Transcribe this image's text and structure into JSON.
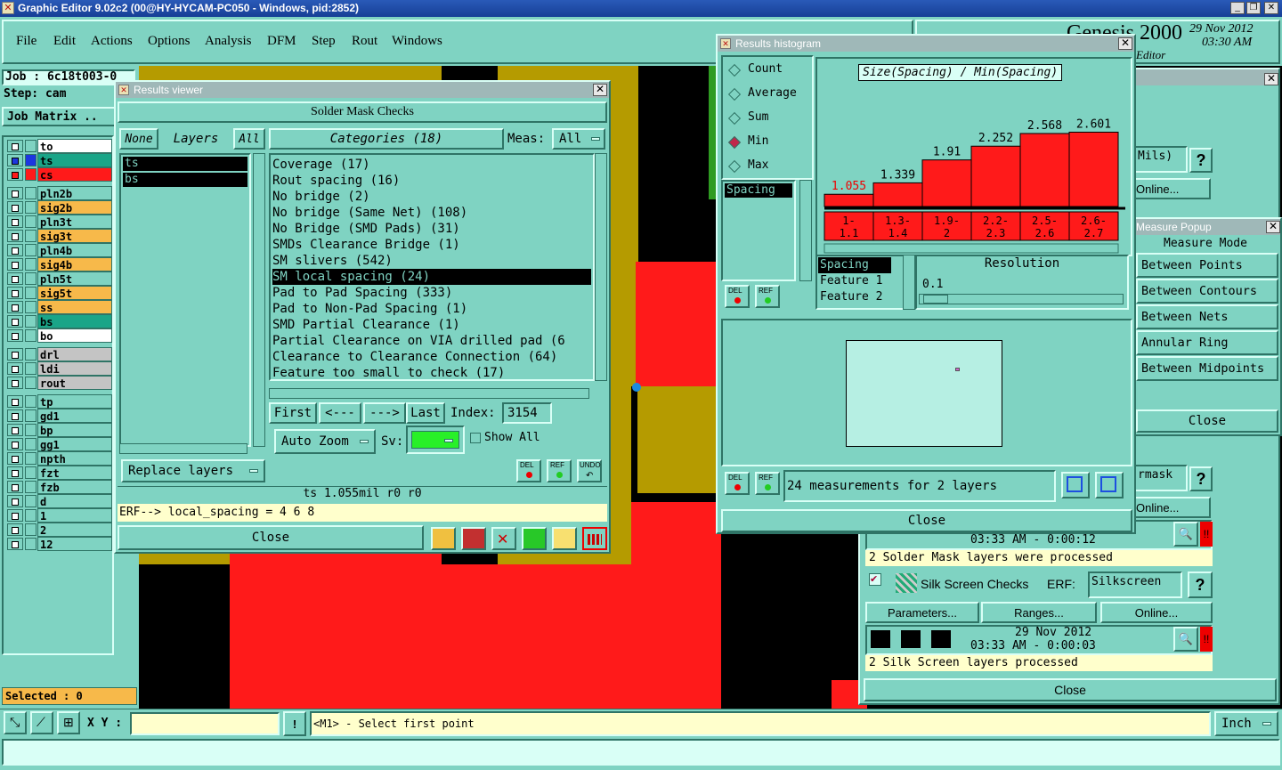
{
  "app": {
    "title": "Graphic Editor 9.02c2 (00@HY-HYCAM-PC050 - Windows, pid:2852)",
    "brand": "Genesis 2000",
    "date": "29 Nov 2012",
    "time": "03:30 AM",
    "sub": "Editor"
  },
  "menu": [
    "File",
    "Edit",
    "Actions",
    "Options",
    "Analysis",
    "DFM",
    "Step",
    "Rout",
    "Windows"
  ],
  "job": {
    "job": "Job : 6c18t003-0",
    "step": "Step: cam",
    "matrix": "Job Matrix .."
  },
  "layers": [
    {
      "name": "to",
      "color": "#ffffff",
      "mark": "none"
    },
    {
      "name": "ts",
      "color": "#1aa588",
      "mark": "blue"
    },
    {
      "name": "cs",
      "color": "#ff1a1a",
      "mark": "red"
    },
    {
      "name": "pln2b",
      "color": "#7fd3c2"
    },
    {
      "name": "sig2b",
      "color": "#f7b94a"
    },
    {
      "name": "pln3t",
      "color": "#7fd3c2"
    },
    {
      "name": "sig3t",
      "color": "#f7b94a"
    },
    {
      "name": "pln4b",
      "color": "#7fd3c2"
    },
    {
      "name": "sig4b",
      "color": "#f7b94a"
    },
    {
      "name": "pln5t",
      "color": "#7fd3c2"
    },
    {
      "name": "sig5t",
      "color": "#f7b94a"
    },
    {
      "name": "ss",
      "color": "#f7b94a"
    },
    {
      "name": "bs",
      "color": "#1aa588"
    },
    {
      "name": "bo",
      "color": "#ffffff"
    },
    {
      "name": "drl",
      "color": "#c4c4c4"
    },
    {
      "name": "ldi",
      "color": "#c4c4c4"
    },
    {
      "name": "rout",
      "color": "#c4c4c4"
    },
    {
      "name": "tp",
      "color": "#7fd3c2"
    },
    {
      "name": "gd1",
      "color": "#7fd3c2"
    },
    {
      "name": "bp",
      "color": "#7fd3c2"
    },
    {
      "name": "gg1",
      "color": "#7fd3c2"
    },
    {
      "name": "npth",
      "color": "#7fd3c2"
    },
    {
      "name": "fzt",
      "color": "#7fd3c2"
    },
    {
      "name": "fzb",
      "color": "#7fd3c2"
    },
    {
      "name": "d",
      "color": "#7fd3c2"
    },
    {
      "name": "1",
      "color": "#7fd3c2"
    },
    {
      "name": "2",
      "color": "#7fd3c2"
    },
    {
      "name": "12",
      "color": "#7fd3c2"
    }
  ],
  "selected": "Selected : 0",
  "viewer": {
    "title": "Results viewer",
    "header": "Solder Mask Checks",
    "none": "None",
    "layers_label": "Layers",
    "all": "All",
    "categories_label": "Categories (18)",
    "meas_label": "Meas:",
    "meas_value": "All",
    "layer_items": [
      "ts",
      "bs"
    ],
    "categories": [
      "Coverage (17)",
      "Rout spacing (16)",
      "No bridge (2)",
      "No bridge (Same Net) (108)",
      "No Bridge (SMD Pads) (31)",
      "SMDs Clearance Bridge (1)",
      "SM slivers (542)",
      "SM local spacing (24)",
      "Pad to Pad Spacing (333)",
      "Pad to Non-Pad Spacing (1)",
      "SMD Partial Clearance (1)",
      "Partial Clearance on VIA drilled pad (6",
      "Clearance to Clearance Connection (64)",
      "Feature too small to check (17)"
    ],
    "selected_index": 7,
    "first": "First",
    "prev": "<---",
    "next": "--->",
    "last": "Last",
    "index_label": "Index:",
    "index_value": "3154",
    "auto_zoom": "Auto Zoom",
    "sv": "Sv:",
    "show_all": "Show All",
    "replace": "Replace layers",
    "del": "DEL",
    "ref": "REF",
    "undo": "UNDO",
    "status": "ts 1.055mil  r0  r0",
    "erf": "ERF--> local_spacing = 4 6 8",
    "close": "Close"
  },
  "hist": {
    "title": "Results histogram",
    "options": [
      "Count",
      "Average",
      "Sum",
      "Min",
      "Max"
    ],
    "selected_option": "Min",
    "chart_title": "Size(Spacing) / Min(Spacing)",
    "list": [
      "Spacing"
    ],
    "del": "DEL",
    "ref": "REF",
    "table": [
      "Spacing",
      "Feature 1",
      "Feature 2"
    ],
    "resolution_label": "Resolution",
    "resolution_value": "0.1",
    "summary": "24 measurements for 2 layers",
    "close": "Close"
  },
  "chart_data": {
    "type": "bar",
    "title": "Size(Spacing) / Min(Spacing)",
    "categories": [
      "1-\n1.1",
      "1.3-\n1.4",
      "1.9-\n2",
      "2.2-\n2.3",
      "2.5-\n2.6",
      "2.6-\n2.7"
    ],
    "category_lines": [
      [
        "1-",
        "1.1"
      ],
      [
        "1.3-",
        "1.4"
      ],
      [
        "1.9-",
        "2"
      ],
      [
        "2.2-",
        "2.3"
      ],
      [
        "2.5-",
        "2.6"
      ],
      [
        "2.6-",
        "2.7"
      ]
    ],
    "values": [
      1.055,
      1.339,
      1.91,
      2.252,
      2.568,
      2.601
    ],
    "labels": [
      "1.055",
      "1.339",
      "1.91",
      "2.252",
      "2.568",
      "2.601"
    ],
    "ylim": [
      0,
      2.8
    ],
    "bar_color": "#ff1a1a",
    "highlight_color": "#ff1a1a"
  },
  "measure": {
    "title": "Measure Popup",
    "mode": "Measure Mode",
    "items": [
      "Between Points",
      "Between Contours",
      "Between Nets",
      "Annular Ring",
      "Between Midpoints"
    ],
    "close": "Close"
  },
  "checks": {
    "mils": "Mils)",
    "online": "Online...",
    "rmask": "rmask",
    "time1": "03:33 AM - 0:00:12",
    "msg1": "2 Solder Mask layers were processed",
    "silk": "Silk Screen Checks",
    "erf": "ERF:",
    "erf_val": "Silkscreen",
    "params": "Parameters...",
    "ranges": "Ranges...",
    "online2": "Online...",
    "date2": "29 Nov 2012",
    "time2": "03:33 AM - 0:00:03",
    "msg2": "2 Silk Screen layers processed",
    "close": "Close",
    "q": "?",
    "excl": "!!"
  },
  "bottom": {
    "xy": "X Y :",
    "msg": "<M1> - Select first point",
    "unit": "Inch",
    "bang": "!"
  }
}
